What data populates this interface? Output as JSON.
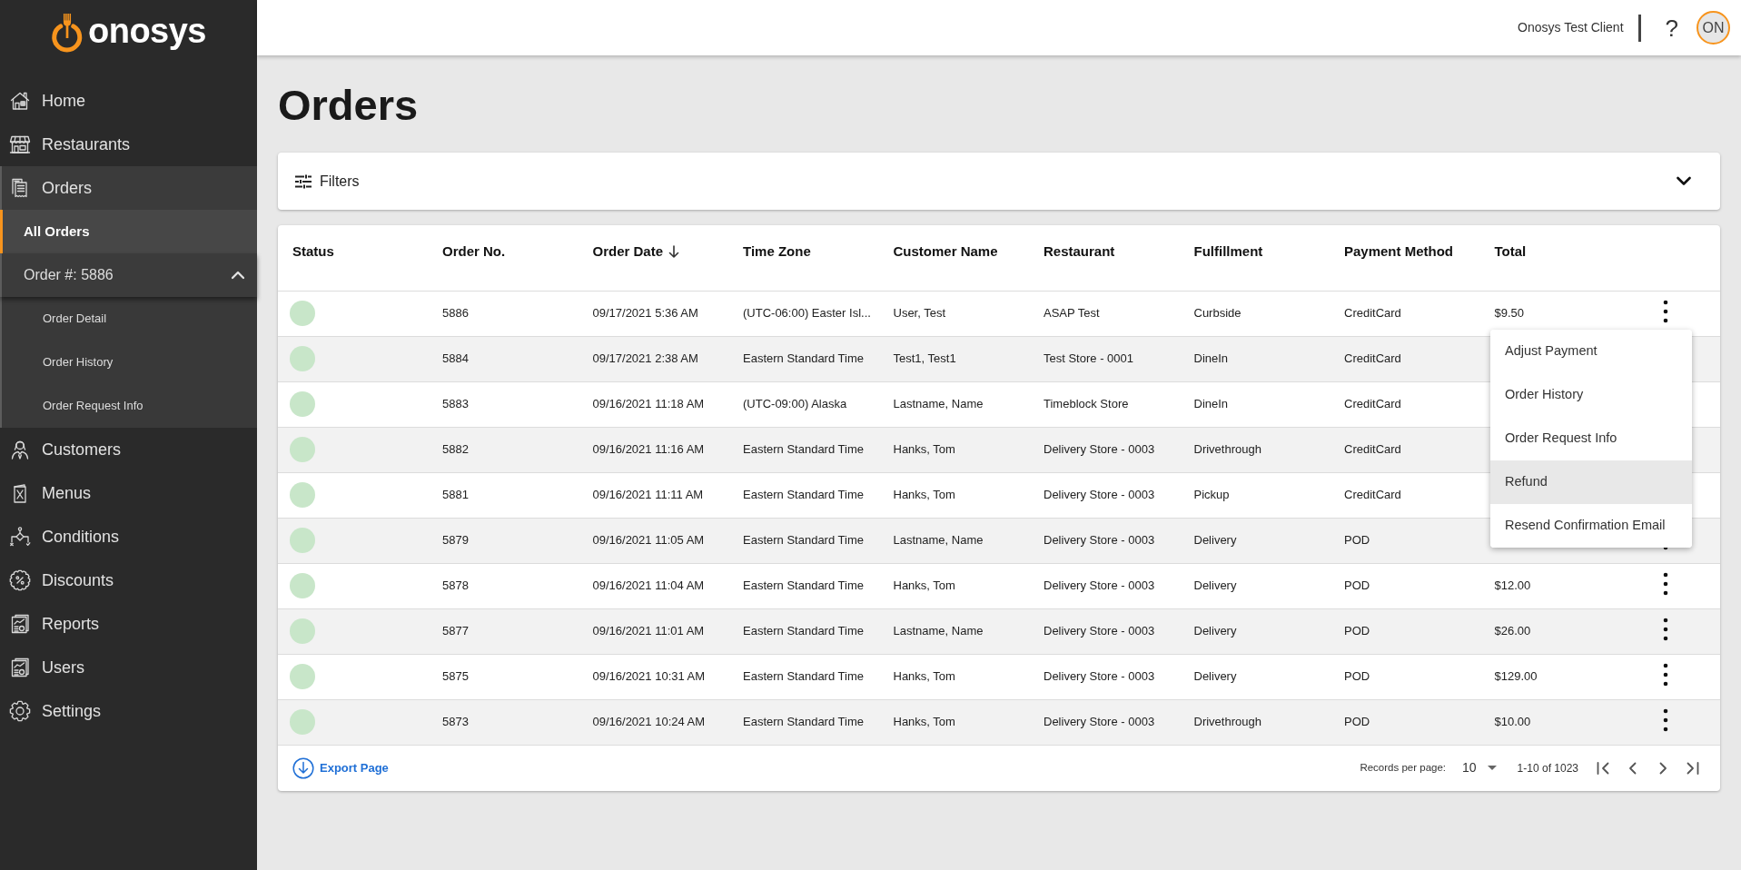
{
  "sidebar": {
    "logo": "onosys",
    "items": [
      {
        "label": "Home",
        "expanded": false
      },
      {
        "label": "Restaurants",
        "expanded": false
      },
      {
        "label": "Orders",
        "expanded": true,
        "children": [
          {
            "label": "All Orders",
            "selected": true
          },
          {
            "label": "Order #: 5886",
            "selected": false,
            "expanded": true,
            "children": [
              {
                "label": "Order Detail",
                "selected": false
              },
              {
                "label": "Order History",
                "selected": false
              },
              {
                "label": "Order Request Info",
                "selected": false
              }
            ]
          }
        ]
      },
      {
        "label": "Customers",
        "expanded": false
      },
      {
        "label": "Menus",
        "expanded": false
      },
      {
        "label": "Conditions",
        "expanded": false
      },
      {
        "label": "Discounts",
        "expanded": false
      },
      {
        "label": "Reports",
        "expanded": false
      },
      {
        "label": "Users",
        "expanded": false
      },
      {
        "label": "Settings",
        "expanded": false
      }
    ]
  },
  "top_bar": {
    "client_name": "Onosys Test Client",
    "help": "?",
    "avatar": "ON"
  },
  "page_title": "Orders",
  "filters": {
    "label": "Filters",
    "expanded": false
  },
  "table": {
    "columns": [
      {
        "label": "Status",
        "sorted": false
      },
      {
        "label": "Order No.",
        "sorted": false
      },
      {
        "label": "Order Date",
        "sorted": true
      },
      {
        "label": "Time Zone",
        "sorted": false
      },
      {
        "label": "Customer Name",
        "sorted": false
      },
      {
        "label": "Restaurant",
        "sorted": false
      },
      {
        "label": "Fulfillment",
        "sorted": false
      },
      {
        "label": "Payment Method",
        "sorted": false
      },
      {
        "label": "Total",
        "sorted": false
      }
    ],
    "rows": [
      {
        "color": "#c8e6c9",
        "order_no": "5886",
        "order_date": "09/17/2021 5:36 AM",
        "time_zone": "(UTC-06:00) Easter Isl...",
        "customer_name": "User, Test",
        "restaurant": "ASAP Test",
        "fulfillment": "Curbside",
        "payment_method": "CreditCard",
        "total": "$9.50"
      },
      {
        "color": "#c8e6c9",
        "order_no": "5884",
        "order_date": "09/17/2021 2:38 AM",
        "time_zone": "Eastern Standard Time",
        "customer_name": "Test1, Test1",
        "restaurant": "Test Store - 0001",
        "fulfillment": "DineIn",
        "payment_method": "CreditCard"
      },
      {
        "color": "#c8e6c9",
        "order_no": "5883",
        "order_date": "09/16/2021 11:18 AM",
        "time_zone": "(UTC-09:00) Alaska",
        "customer_name": "Lastname, Name",
        "restaurant": "Timeblock Store",
        "fulfillment": "DineIn",
        "payment_method": "CreditCard"
      },
      {
        "color": "#c8e6c9",
        "order_no": "5882",
        "order_date": "09/16/2021 11:16 AM",
        "time_zone": "Eastern Standard Time",
        "customer_name": "Hanks, Tom",
        "restaurant": "Delivery Store - 0003",
        "fulfillment": "Drivethrough",
        "payment_method": "CreditCard"
      },
      {
        "color": "#c8e6c9",
        "order_no": "5881",
        "order_date": "09/16/2021 11:11 AM",
        "time_zone": "Eastern Standard Time",
        "customer_name": "Hanks, Tom",
        "restaurant": "Delivery Store - 0003",
        "fulfillment": "Pickup",
        "payment_method": "CreditCard"
      },
      {
        "color": "#c8e6c9",
        "order_no": "5879",
        "order_date": "09/16/2021 11:05 AM",
        "time_zone": "Eastern Standard Time",
        "customer_name": "Lastname, Name",
        "restaurant": "Delivery Store - 0003",
        "fulfillment": "Delivery",
        "payment_method": "POD"
      },
      {
        "color": "#c8e6c9",
        "order_no": "5878",
        "order_date": "09/16/2021 11:04 AM",
        "time_zone": "Eastern Standard Time",
        "customer_name": "Hanks, Tom",
        "restaurant": "Delivery Store - 0003",
        "fulfillment": "Delivery",
        "payment_method": "POD",
        "total": "$12.00"
      },
      {
        "color": "#c8e6c9",
        "order_no": "5877",
        "order_date": "09/16/2021 11:01 AM",
        "time_zone": "Eastern Standard Time",
        "customer_name": "Lastname, Name",
        "restaurant": "Delivery Store - 0003",
        "fulfillment": "Delivery",
        "payment_method": "POD",
        "total": "$26.00"
      },
      {
        "color": "#c8e6c9",
        "order_no": "5875",
        "order_date": "09/16/2021 10:31 AM",
        "time_zone": "Eastern Standard Time",
        "customer_name": "Hanks, Tom",
        "restaurant": "Delivery Store - 0003",
        "fulfillment": "Delivery",
        "payment_method": "POD",
        "total": "$129.00"
      },
      {
        "color": "#c8e6c9",
        "order_no": "5873",
        "order_date": "09/16/2021 10:24 AM",
        "time_zone": "Eastern Standard Time",
        "customer_name": "Hanks, Tom",
        "restaurant": "Delivery Store - 0003",
        "fulfillment": "Drivethrough",
        "payment_method": "POD",
        "total": "$10.00"
      }
    ]
  },
  "row_menu": {
    "items": [
      {
        "label": "Adjust Payment",
        "highlighted": false
      },
      {
        "label": "Order History",
        "highlighted": false
      },
      {
        "label": "Order Request Info",
        "highlighted": false
      },
      {
        "label": "Refund",
        "highlighted": true
      },
      {
        "label": "Resend Confirmation Email",
        "highlighted": false
      }
    ]
  },
  "footer": {
    "export_label": "Export Page",
    "records_per_page_label": "Records per page:",
    "records_per_page": "10",
    "range": "1-10 of 1023"
  }
}
